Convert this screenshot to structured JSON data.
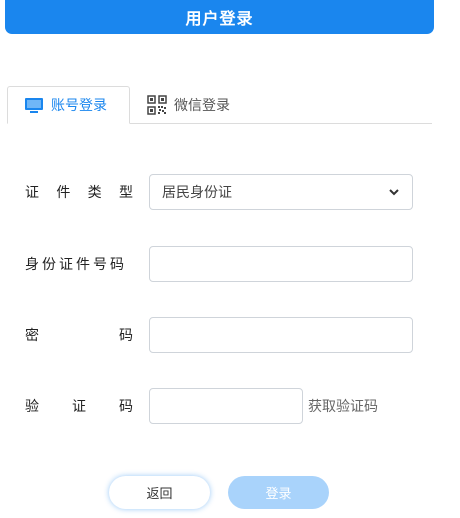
{
  "header": {
    "title": "用户登录"
  },
  "tabs": [
    {
      "label": "账号登录",
      "icon": "monitor-icon",
      "active": true
    },
    {
      "label": "微信登录",
      "icon": "qr-code-icon",
      "active": false
    }
  ],
  "form": {
    "id_type": {
      "label_chars": [
        "证",
        "件",
        "类",
        "型"
      ],
      "value": "居民身份证"
    },
    "id_number": {
      "label": "身份证件号码",
      "value": ""
    },
    "password": {
      "label_chars": [
        "密",
        "码"
      ],
      "value": ""
    },
    "captcha": {
      "label_chars": [
        "验",
        "证",
        "码"
      ],
      "value": "",
      "get_code": "获取验证码"
    }
  },
  "buttons": {
    "back": "返回",
    "login": "登录"
  },
  "colors": {
    "accent": "#1a86ee",
    "login_disabled": "#a9d3fb",
    "border": "#cfd4da"
  }
}
